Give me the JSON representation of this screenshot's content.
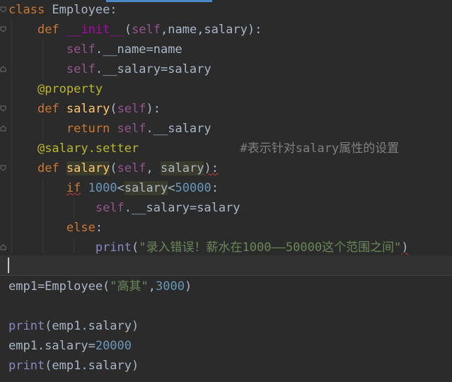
{
  "editor": {
    "accent_color": "#4a88c7",
    "lines": {
      "l1_kw": "class",
      "l1_rest": " Employee:",
      "l2_kw": "def",
      "l2_name": "__init__",
      "l2_p1": "(",
      "l2_self": "self",
      "l2_p2": ",name,salary):",
      "l3_self": "self",
      "l3_rest": ".__name=name",
      "l4_self": "self",
      "l4_rest": ".__salary=salary",
      "l5_deco": "@property",
      "l6_kw": "def",
      "l6_name": "salary",
      "l6_p1": "(",
      "l6_self": "self",
      "l6_p2": "):",
      "l7_kw": "return",
      "l7_self": "self",
      "l7_rest": ".__salary",
      "l8_deco": "@salary.setter",
      "l8_cmt": "#表示针对salary属性的设置",
      "l9_kw": "def",
      "l9_name": "salary",
      "l9_p1": "(",
      "l9_self": "self",
      "l9_p2": ", ",
      "l9_arg": "salary",
      "l9_p3": "):",
      "l10_kw": "if",
      "l10_num1": "1000",
      "l10_lt1": "<",
      "l10_var": "salary",
      "l10_lt2": "<",
      "l10_num2": "50000",
      "l10_colon": ":",
      "l11_self": "self",
      "l11_rest": ".__salary=salary",
      "l12_kw": "else",
      "l12_colon": ":",
      "l13_fn": "print",
      "l13_p1": "(",
      "l13_str": "\"录入错误！薪水在1000——50000这个范围之间\"",
      "l13_p2": ")",
      "l15_a": "emp1=Employee(",
      "l15_str": "\"高其\"",
      "l15_comma": ",",
      "l15_num": "3000",
      "l15_p": ")",
      "l17_fn": "print",
      "l17_rest": "(emp1.salary)",
      "l18_a": "emp1.salary=",
      "l18_num": "20000",
      "l19_fn": "print",
      "l19_rest": "(emp1.salary)"
    }
  }
}
